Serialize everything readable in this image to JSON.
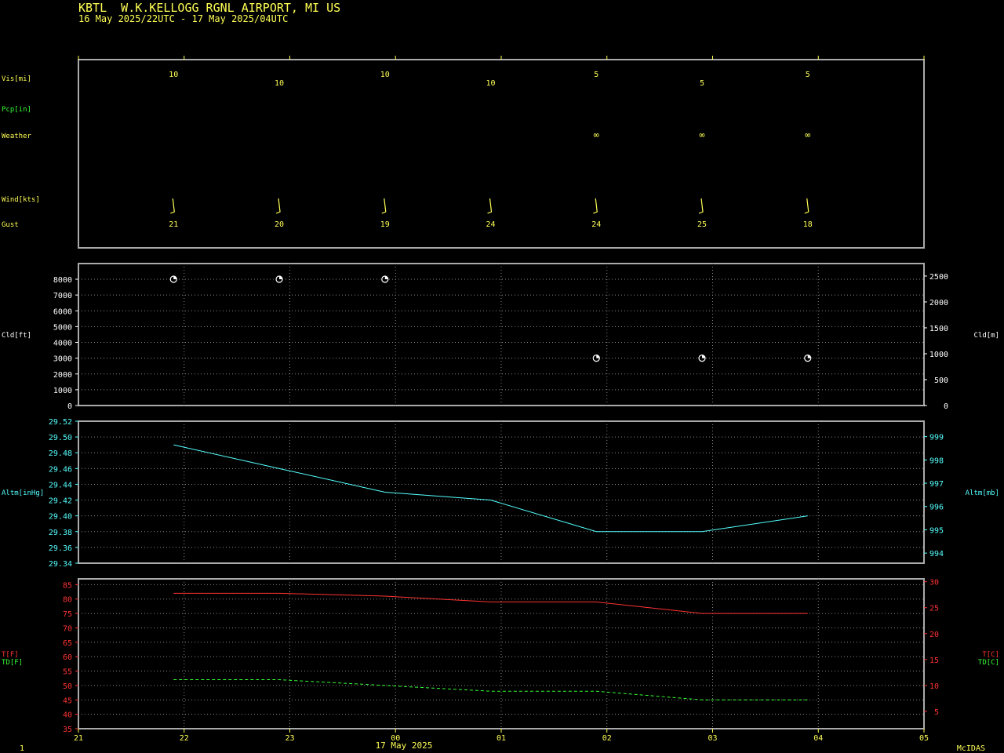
{
  "header": {
    "title": "KBTL  W.K.KELLOGG RGNL AIRPORT, MI US",
    "subtitle": "16 May 2025/22UTC - 17 May 2025/04UTC"
  },
  "footer": {
    "page_number": "1",
    "date_label": "17 May 2025",
    "credit": "McIDAS"
  },
  "colors": {
    "background": "#000000",
    "frame": "#aaaaaa",
    "grid": "#888888",
    "yellow": "#ffff55",
    "green": "#33ff33",
    "cyan": "#55ffff",
    "red": "#ff3333",
    "white": "#ffffff"
  },
  "chart_data": [
    {
      "type": "table",
      "title": "Surface observations",
      "x_hours": [
        21.9,
        22.9,
        23.9,
        24.9,
        25.9,
        26.9,
        27.9
      ],
      "rows": [
        {
          "label": "Vis[mi]",
          "values": [
            "10",
            "10",
            "10",
            "10",
            "5",
            "5",
            "5"
          ]
        },
        {
          "label": "Pcp[in]",
          "values": []
        },
        {
          "label": "Weather",
          "values": [
            "",
            "",
            "",
            "",
            "∞",
            "∞",
            "∞"
          ]
        },
        {
          "label": "Wind[kts]",
          "values": [
            "barb",
            "barb",
            "barb",
            "barb",
            "barb",
            "barb",
            "barb"
          ]
        },
        {
          "label": "Gust",
          "values": [
            "21",
            "20",
            "19",
            "24",
            "24",
            "25",
            "18"
          ]
        }
      ]
    },
    {
      "type": "scatter",
      "ylabel": "Cld[ft]",
      "ylabel_right": "Cld[m]",
      "ylim": [
        0,
        8000
      ],
      "yticks": [
        0,
        1000,
        2000,
        3000,
        4000,
        5000,
        6000,
        7000,
        8000
      ],
      "right_yticks_m": [
        0,
        500,
        1000,
        1500,
        2000,
        2500
      ],
      "grid": true,
      "points": [
        {
          "x": 21.9,
          "y": 8000,
          "cover": "scattered"
        },
        {
          "x": 22.9,
          "y": 8000,
          "cover": "scattered"
        },
        {
          "x": 23.9,
          "y": 8000,
          "cover": "scattered"
        },
        {
          "x": 25.9,
          "y": 3000,
          "cover": "scattered"
        },
        {
          "x": 26.9,
          "y": 3000,
          "cover": "scattered"
        },
        {
          "x": 27.9,
          "y": 3000,
          "cover": "scattered"
        }
      ]
    },
    {
      "type": "line",
      "ylabel": "Altm[inHg]",
      "ylabel_right": "Altm[mb]",
      "ylim": [
        29.34,
        29.52
      ],
      "yticks": [
        29.34,
        29.36,
        29.38,
        29.4,
        29.42,
        29.44,
        29.46,
        29.48,
        29.5,
        29.52
      ],
      "right_yticks_mb": [
        994,
        995,
        996,
        997,
        998,
        999
      ],
      "grid": true,
      "series": [
        {
          "x": [
            21.9,
            22.9,
            23.9,
            24.9,
            25.9,
            26.9,
            27.9
          ],
          "values": [
            29.49,
            29.46,
            29.43,
            29.42,
            29.38,
            29.38,
            29.4
          ]
        }
      ]
    },
    {
      "type": "line",
      "ylabel": "T[F]",
      "ylabel2": "TD[F]",
      "ylabel_right": "T[C]",
      "ylabel2_right": "TD[C]",
      "ylim": [
        35,
        87
      ],
      "yticks": [
        35,
        40,
        45,
        50,
        55,
        60,
        65,
        70,
        75,
        80,
        85
      ],
      "right_yticks_c": [
        5,
        10,
        15,
        20,
        25,
        30
      ],
      "grid": true,
      "series": [
        {
          "key": "t",
          "x": [
            21.9,
            22.9,
            23.9,
            24.9,
            25.9,
            26.9,
            27.9
          ],
          "values": [
            82,
            82,
            81,
            79,
            79,
            75,
            75
          ]
        },
        {
          "key": "td",
          "x": [
            21.9,
            22.9,
            23.9,
            24.9,
            25.9,
            26.9,
            27.9
          ],
          "values": [
            52,
            52,
            50,
            48,
            48,
            45,
            45
          ]
        }
      ]
    }
  ],
  "x_axis": {
    "range_hours": [
      21,
      29
    ],
    "tick_labels": [
      "21",
      "22",
      "23",
      "00",
      "01",
      "02",
      "03",
      "04",
      "05"
    ]
  }
}
